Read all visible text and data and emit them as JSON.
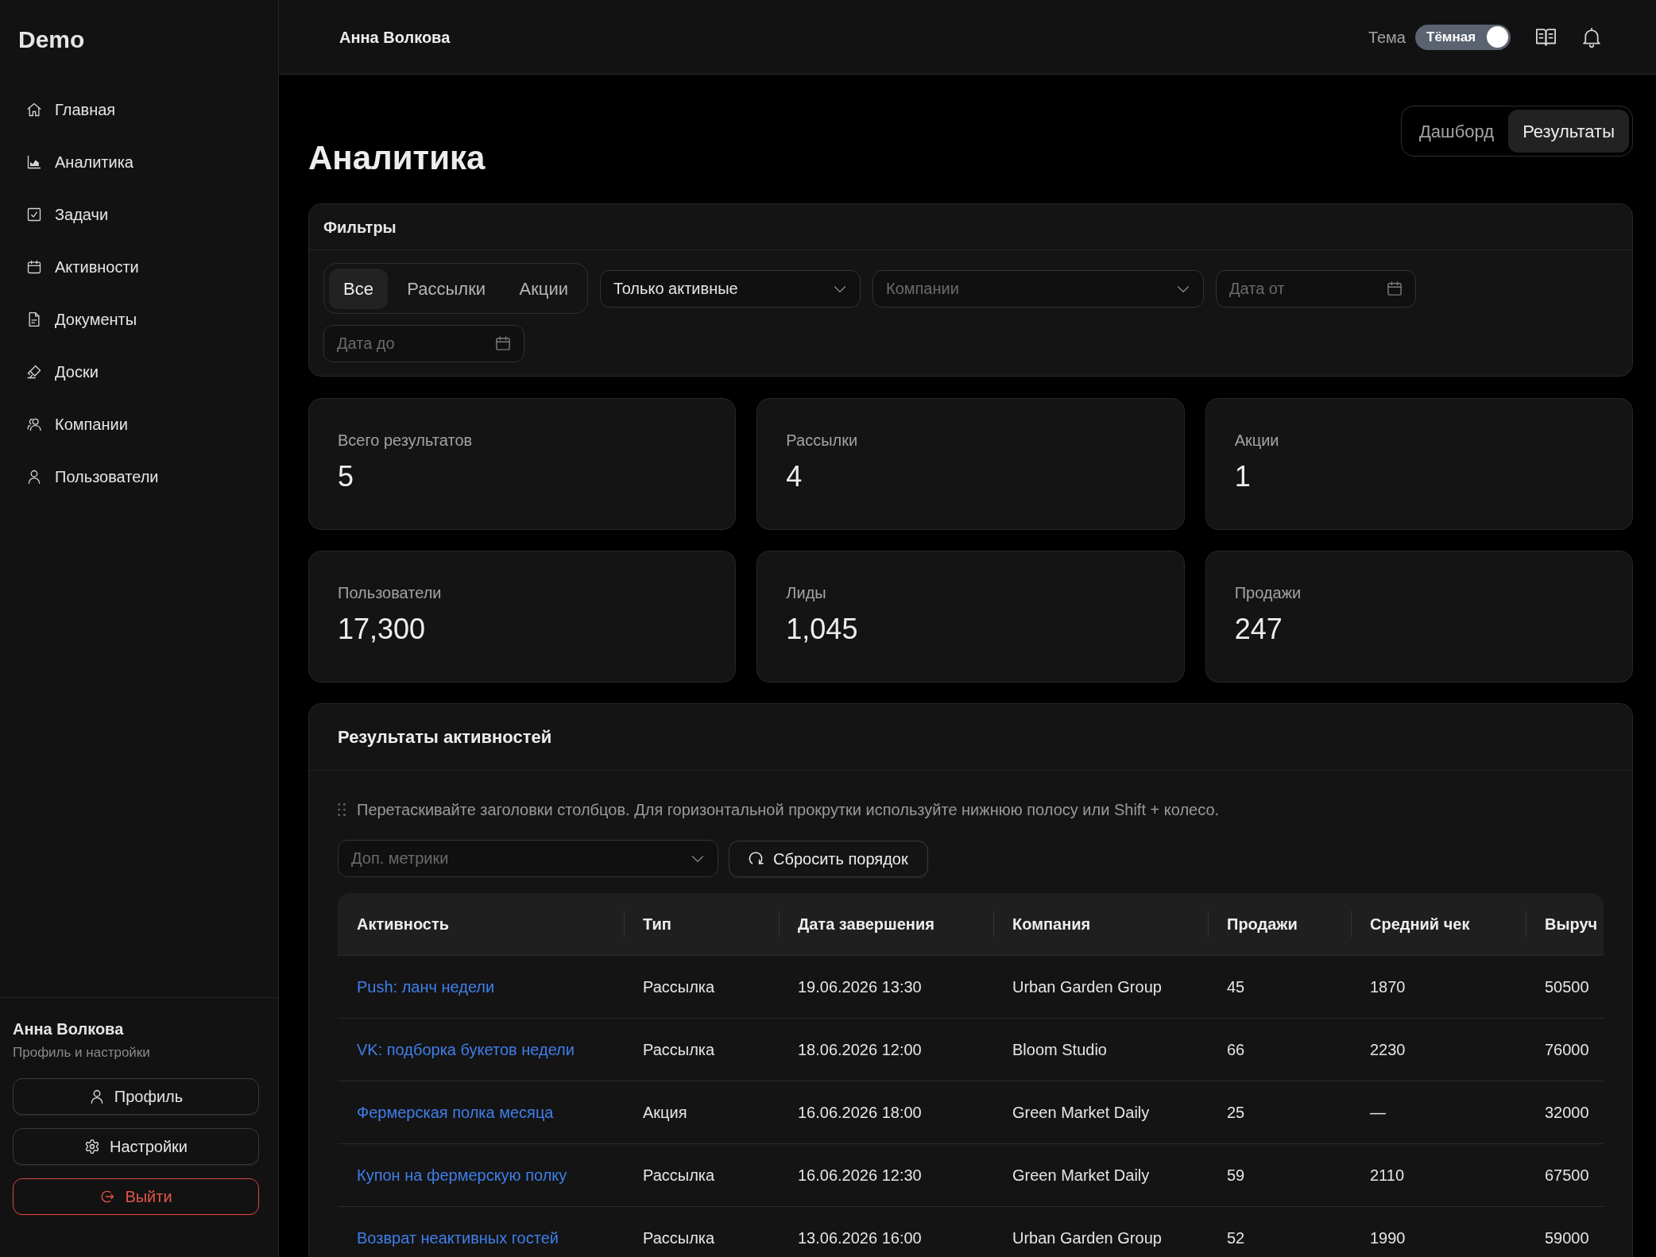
{
  "sidebar": {
    "logo": "Demo",
    "items": [
      {
        "label": "Главная"
      },
      {
        "label": "Аналитика"
      },
      {
        "label": "Задачи"
      },
      {
        "label": "Активности"
      },
      {
        "label": "Документы"
      },
      {
        "label": "Доски"
      },
      {
        "label": "Компании"
      },
      {
        "label": "Пользователи"
      }
    ],
    "user": {
      "name": "Анна Волкова",
      "subtitle": "Профиль и настройки"
    },
    "buttons": [
      {
        "label": "Профиль",
        "kind": "default"
      },
      {
        "label": "Настройки",
        "kind": "default"
      },
      {
        "label": "Выйти",
        "kind": "danger"
      }
    ]
  },
  "header": {
    "user_name": "Анна Волкова",
    "theme_label": "Тема",
    "theme_toggle": {
      "label": "Тёмная",
      "on": true
    }
  },
  "page": {
    "title": "Аналитика",
    "view_tabs": [
      {
        "label": "Дашборд",
        "selected": false
      },
      {
        "label": "Результаты",
        "selected": true
      }
    ]
  },
  "filters": {
    "title": "Фильтры",
    "type_tabs": [
      {
        "label": "Все",
        "selected": true
      },
      {
        "label": "Рассылки",
        "selected": false
      },
      {
        "label": "Акции",
        "selected": false
      }
    ],
    "fields": [
      {
        "kind": "select",
        "value": "Только активные"
      },
      {
        "kind": "select",
        "placeholder": "Компании"
      },
      {
        "kind": "date",
        "placeholder": "Дата от"
      },
      {
        "kind": "date",
        "placeholder": "Дата до"
      }
    ]
  },
  "stats": [
    {
      "label": "Всего результатов",
      "value": "5"
    },
    {
      "label": "Рассылки",
      "value": "4"
    },
    {
      "label": "Акции",
      "value": "1"
    },
    {
      "label": "Пользователи",
      "value": "17,300"
    },
    {
      "label": "Лиды",
      "value": "1,045"
    },
    {
      "label": "Продажи",
      "value": "247"
    }
  ],
  "results": {
    "title": "Результаты активностей",
    "hint": "Перетаскивайте заголовки столбцов. Для горизонтальной прокрутки используйте нижнюю полосу или Shift + колесо.",
    "metrics_select": {
      "placeholder": "Доп. метрики"
    },
    "reset_button": "Сбросить порядок",
    "table": {
      "columns": [
        "Активность",
        "Тип",
        "Дата завершения",
        "Компания",
        "Продажи",
        "Средний чек",
        "Выруч"
      ],
      "rows": [
        [
          "Push: ланч недели",
          "Рассылка",
          "19.06.2026 13:30",
          "Urban Garden Group",
          "45",
          "1870",
          "50500"
        ],
        [
          "VK: подборка букетов недели",
          "Рассылка",
          "18.06.2026 12:00",
          "Bloom Studio",
          "66",
          "2230",
          "76000"
        ],
        [
          "Фермерская полка месяца",
          "Акция",
          "16.06.2026 18:00",
          "Green Market Daily",
          "25",
          "—",
          "32000"
        ],
        [
          "Купон на фермерскую полку",
          "Рассылка",
          "16.06.2026 12:30",
          "Green Market Daily",
          "59",
          "2110",
          "67500"
        ],
        [
          "Возврат неактивных гостей",
          "Рассылка",
          "13.06.2026 16:00",
          "Urban Garden Group",
          "52",
          "1990",
          "59000"
        ]
      ]
    }
  }
}
